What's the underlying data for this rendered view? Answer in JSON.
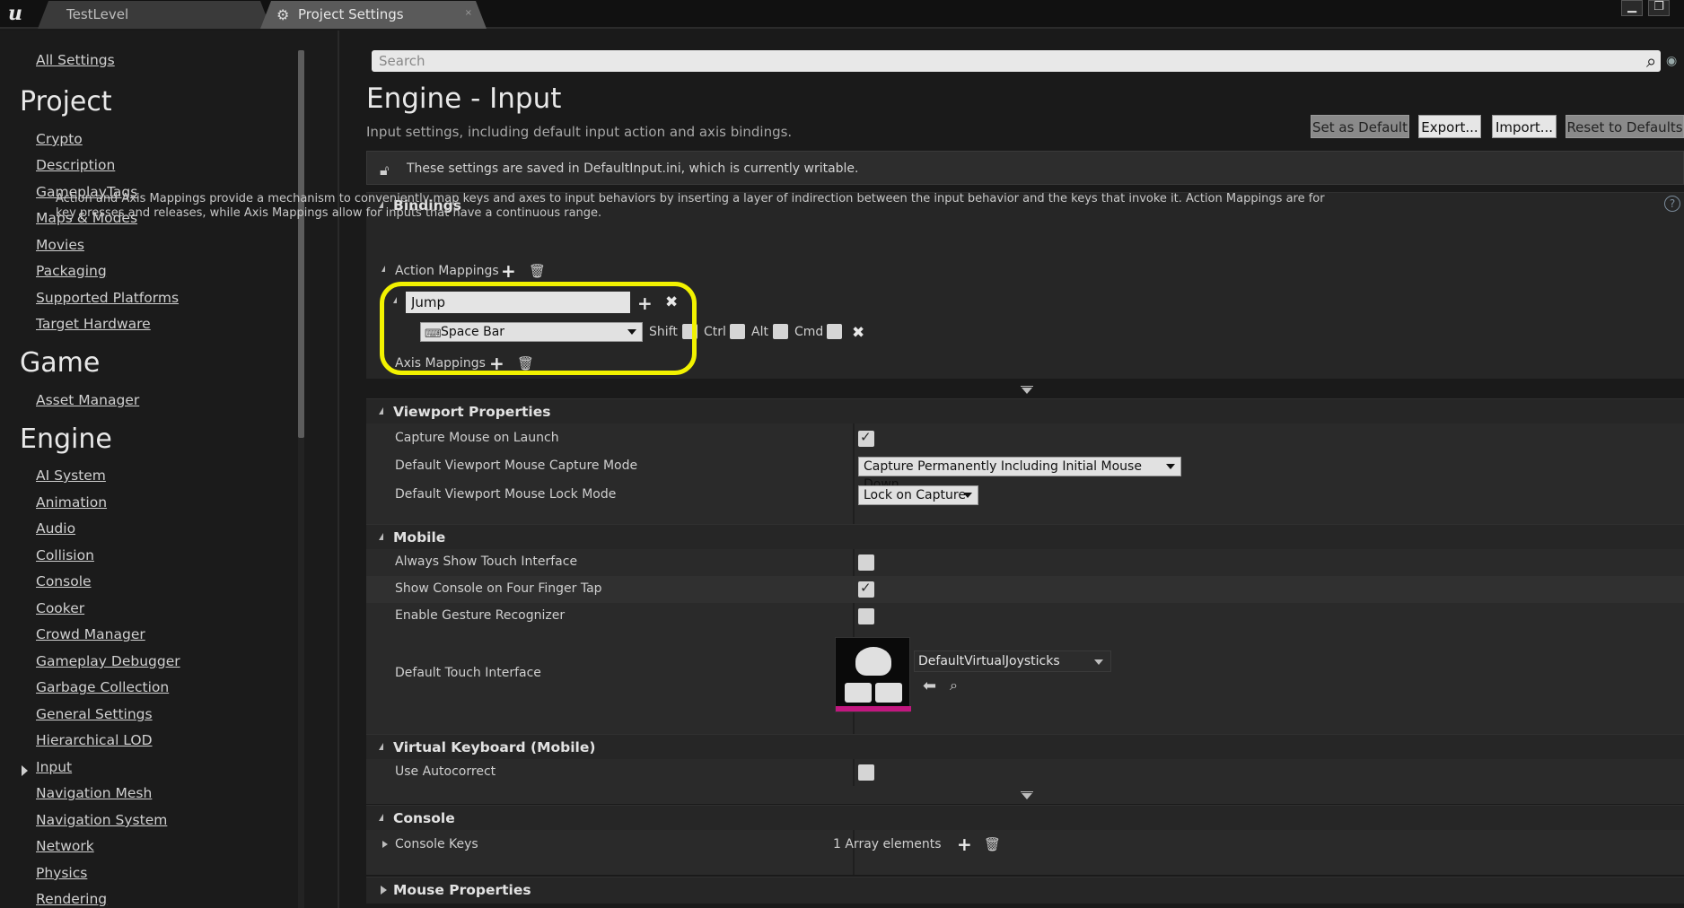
{
  "tabs": [
    {
      "label": "TestLevel"
    },
    {
      "label": "Project Settings",
      "close": "×"
    }
  ],
  "window": {
    "minimize": "▁",
    "maximize": "❐"
  },
  "sidebar": {
    "all_settings": "All Settings",
    "sections": [
      {
        "heading": "Project",
        "items": [
          "Crypto",
          "Description",
          "GameplayTags",
          "Maps & Modes",
          "Movies",
          "Packaging",
          "Supported Platforms",
          "Target Hardware"
        ]
      },
      {
        "heading": "Game",
        "items": [
          "Asset Manager"
        ]
      },
      {
        "heading": "Engine",
        "items": [
          "AI System",
          "Animation",
          "Audio",
          "Collision",
          "Console",
          "Cooker",
          "Crowd Manager",
          "Gameplay Debugger",
          "Garbage Collection",
          "General Settings",
          "Hierarchical LOD",
          "Input",
          "Navigation Mesh",
          "Navigation System",
          "Network",
          "Physics",
          "Rendering"
        ]
      }
    ],
    "selected_item": "Input"
  },
  "search": {
    "placeholder": "Search"
  },
  "page": {
    "title": "Engine - Input",
    "description": "Input settings, including default input action and axis bindings.",
    "buttons": {
      "set_default": "Set as Default",
      "export": "Export...",
      "import": "Import...",
      "reset": "Reset to Defaults"
    },
    "notice": "These settings are saved in DefaultInput.ini, which is currently writable."
  },
  "bindings": {
    "title": "Bindings",
    "description": "Action and Axis Mappings provide a mechanism to conveniently map keys and axes to input behaviors by inserting a layer of indirection between the input behavior and the keys that invoke it. Action Mappings are for key presses and releases, while Axis Mappings allow for inputs that have a continuous range.",
    "action_mappings_label": "Action Mappings",
    "axis_mappings_label": "Axis Mappings",
    "action": {
      "name": "Jump",
      "key": "Space Bar",
      "modifiers": [
        "Shift",
        "Ctrl",
        "Alt",
        "Cmd"
      ]
    }
  },
  "viewport": {
    "title": "Viewport Properties",
    "rows": [
      {
        "label": "Capture Mouse on Launch",
        "checked": true
      },
      {
        "label": "Default Viewport Mouse Capture Mode",
        "value": "Capture Permanently Including Initial Mouse Down"
      },
      {
        "label": "Default Viewport Mouse Lock Mode",
        "value": "Lock on Capture"
      }
    ]
  },
  "mobile": {
    "title": "Mobile",
    "rows": [
      {
        "label": "Always Show Touch Interface",
        "checked": false
      },
      {
        "label": "Show Console on Four Finger Tap",
        "checked": true
      },
      {
        "label": "Enable Gesture Recognizer",
        "checked": false
      },
      {
        "label": "Default Touch Interface",
        "value": "DefaultVirtualJoysticks"
      }
    ]
  },
  "virtual_keyboard": {
    "title": "Virtual Keyboard (Mobile)",
    "rows": [
      {
        "label": "Use Autocorrect",
        "checked": false
      }
    ]
  },
  "console": {
    "title": "Console",
    "rows": [
      {
        "label": "Console Keys",
        "value": "1 Array elements"
      }
    ]
  },
  "mouse": {
    "title": "Mouse Properties"
  },
  "colors": {
    "highlight": "#f2f200",
    "touch_accent": "#c2177f"
  }
}
